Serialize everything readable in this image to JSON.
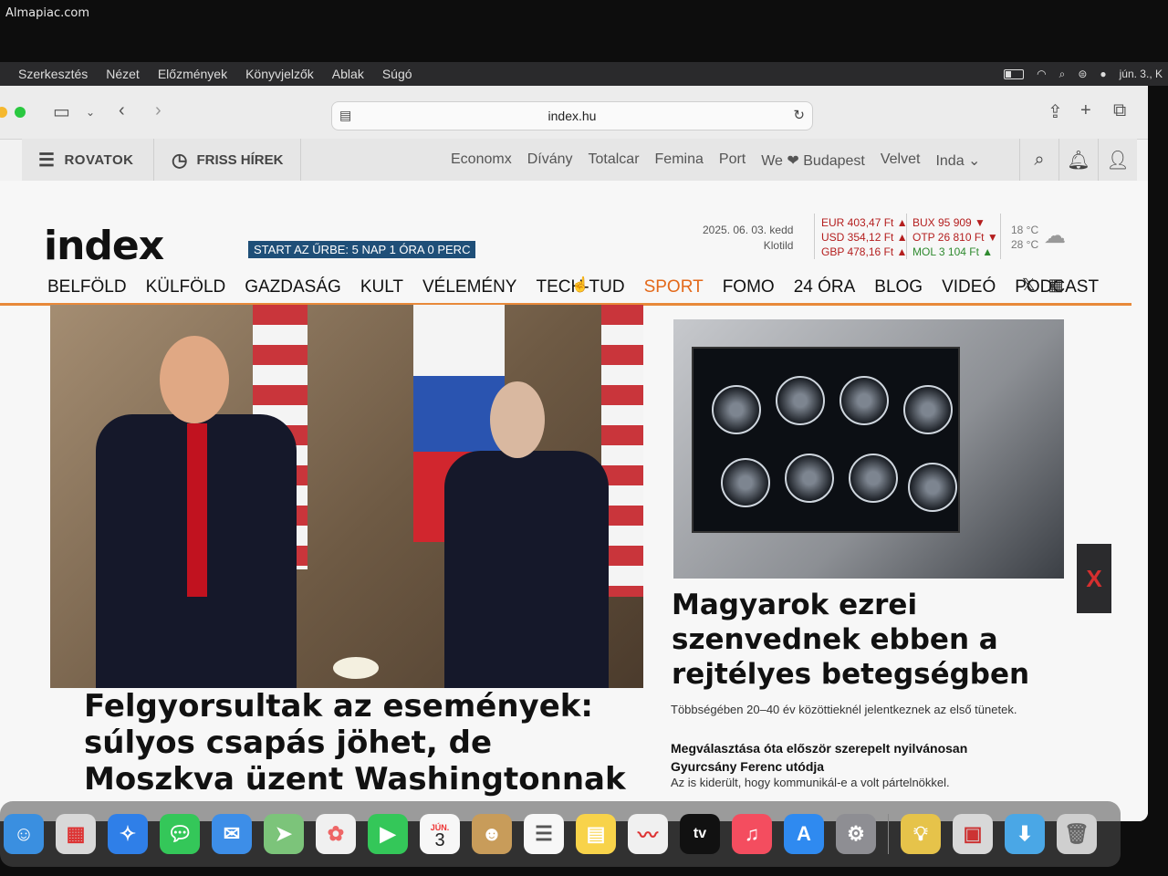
{
  "watermark": "Almapiac.com",
  "menubar": {
    "items": [
      "Szerkesztés",
      "Nézet",
      "Előzmények",
      "Könyvjelzők",
      "Ablak",
      "Súgó"
    ],
    "date": "jún. 3., K"
  },
  "browser": {
    "url": "index.hu"
  },
  "site_header": {
    "rovatok": "ROVATOK",
    "friss_hirek": "FRISS HÍREK",
    "partners": [
      "Economx",
      "Dívány",
      "Totalcar",
      "Femina",
      "Port",
      "We ❤ Budapest",
      "Velvet",
      "Inda ⌄"
    ]
  },
  "masthead": {
    "logo": "index",
    "orbit_banner": "START AZ ŰRBE: 5 NAP 1 ÓRA 0 PERC",
    "date": "2025. 06. 03. kedd",
    "nameday": "Klotild",
    "fx_left": [
      "EUR 403,47 Ft ▲",
      "USD 354,12 Ft ▲",
      "GBP 478,16 Ft ▲"
    ],
    "fx_right": [
      "BUX 95 909 ▼",
      "OTP 26 810 Ft ▼",
      "MOL 3 104 Ft ▲"
    ],
    "weather": [
      "18 °C",
      "28 °C"
    ]
  },
  "nav": {
    "items": [
      "BELFÖLD",
      "KÜLFÖLD",
      "GAZDASÁG",
      "KULT",
      "VÉLEMÉNY",
      "TECH-TUD"
    ],
    "sport": "SPORT",
    "items2": [
      "FOMO",
      "24 ÓRA",
      "BLOG",
      "VIDEÓ",
      "PODCAST"
    ]
  },
  "articles": {
    "main_headline": "Felgyorsultak az események: súlyos csapás jöhet, de Moszkva üzent Washingtonnak",
    "side_headline": "Magyarok ezrei szenvednek ebben a rejtélyes betegségben",
    "side_lead": "Többségében 20–40 év közöttieknél jelentkeznek az első tünetek.",
    "sub_headline": "Megválasztása óta először szerepelt nyilvánosan Gyurcsány Ferenc utódja",
    "sub_lead": "Az is kiderült, hogy kommunikál-e a volt pártelnökkel."
  },
  "dock": {
    "calendar_month": "JÚN.",
    "calendar_day": "3",
    "tv_label": "tv"
  }
}
